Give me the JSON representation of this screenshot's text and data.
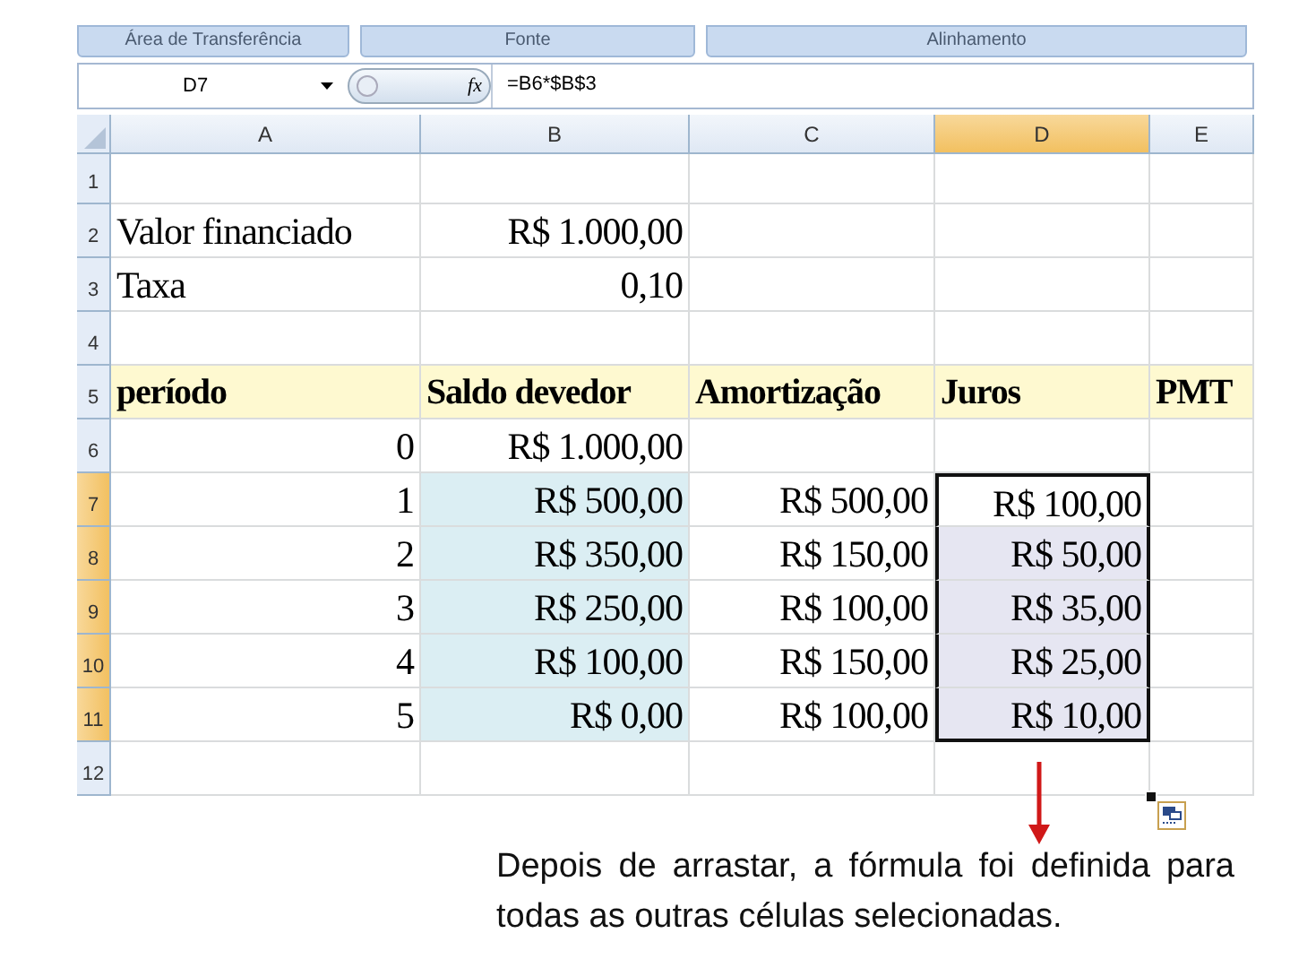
{
  "ribbon_groups": [
    "Área de Transferência",
    "Fonte",
    "Alinhamento"
  ],
  "formula_bar": {
    "name_box": "D7",
    "fx": "fx",
    "formula": "=B6*$B$3"
  },
  "columns": [
    {
      "label": "A",
      "selected": false
    },
    {
      "label": "B",
      "selected": false
    },
    {
      "label": "C",
      "selected": false
    },
    {
      "label": "D",
      "selected": true
    },
    {
      "label": "E",
      "selected": false
    }
  ],
  "rows": [
    {
      "number": "1",
      "selected": false,
      "band": false,
      "cells": [
        {
          "kind": "blank",
          "highlight": false,
          "selected": false
        },
        {
          "kind": "blank",
          "highlight": false,
          "selected": false
        },
        {
          "kind": "blank",
          "highlight": false,
          "selected": false
        },
        {
          "kind": "blank",
          "highlight": false,
          "selected": false
        },
        {
          "kind": "blank",
          "highlight": false,
          "selected": false
        }
      ]
    },
    {
      "number": "2",
      "selected": false,
      "band": false,
      "cells": [
        {
          "kind": "label",
          "text": "Valor financiado",
          "highlight": false,
          "selected": false
        },
        {
          "kind": "value",
          "text": "R$ 1.000,00",
          "highlight": false,
          "selected": false
        },
        {
          "kind": "blank",
          "highlight": false,
          "selected": false
        },
        {
          "kind": "blank",
          "highlight": false,
          "selected": false
        },
        {
          "kind": "blank",
          "highlight": false,
          "selected": false
        }
      ]
    },
    {
      "number": "3",
      "selected": false,
      "band": false,
      "cells": [
        {
          "kind": "label",
          "text": "Taxa",
          "highlight": false,
          "selected": false
        },
        {
          "kind": "value",
          "text": "0,10",
          "highlight": false,
          "selected": false
        },
        {
          "kind": "blank",
          "highlight": false,
          "selected": false
        },
        {
          "kind": "blank",
          "highlight": false,
          "selected": false
        },
        {
          "kind": "blank",
          "highlight": false,
          "selected": false
        }
      ]
    },
    {
      "number": "4",
      "selected": false,
      "band": false,
      "cells": [
        {
          "kind": "blank",
          "highlight": false,
          "selected": false
        },
        {
          "kind": "blank",
          "highlight": false,
          "selected": false
        },
        {
          "kind": "blank",
          "highlight": false,
          "selected": false
        },
        {
          "kind": "blank",
          "highlight": false,
          "selected": false
        },
        {
          "kind": "blank",
          "highlight": false,
          "selected": false
        }
      ]
    },
    {
      "number": "5",
      "selected": false,
      "band": true,
      "cells": [
        {
          "kind": "heading",
          "text": "período",
          "highlight": false,
          "selected": false
        },
        {
          "kind": "heading",
          "text": "Saldo devedor",
          "highlight": false,
          "selected": false
        },
        {
          "kind": "heading",
          "text": "Amortização",
          "highlight": false,
          "selected": false
        },
        {
          "kind": "heading",
          "text": "Juros",
          "highlight": false,
          "selected": false
        },
        {
          "kind": "heading",
          "text": "PMT",
          "highlight": false,
          "selected": false
        }
      ]
    },
    {
      "number": "6",
      "selected": false,
      "band": false,
      "cells": [
        {
          "kind": "value",
          "text": "0",
          "highlight": false,
          "selected": false
        },
        {
          "kind": "value",
          "text": "R$ 1.000,00",
          "highlight": false,
          "selected": false
        },
        {
          "kind": "blank",
          "highlight": false,
          "selected": false
        },
        {
          "kind": "blank",
          "highlight": false,
          "selected": false
        },
        {
          "kind": "blank",
          "highlight": false,
          "selected": false
        }
      ]
    },
    {
      "number": "7",
      "selected": true,
      "band": false,
      "cells": [
        {
          "kind": "value",
          "text": "1",
          "highlight": false,
          "selected": false
        },
        {
          "kind": "value",
          "text": "R$ 500,00",
          "highlight": true,
          "selected": false
        },
        {
          "kind": "value",
          "text": "R$ 500,00",
          "highlight": false,
          "selected": false
        },
        {
          "kind": "value",
          "text": "R$ 100,00",
          "highlight": false,
          "selected": true
        },
        {
          "kind": "blank",
          "highlight": false,
          "selected": false
        }
      ]
    },
    {
      "number": "8",
      "selected": true,
      "band": false,
      "cells": [
        {
          "kind": "value",
          "text": "2",
          "highlight": false,
          "selected": false
        },
        {
          "kind": "value",
          "text": "R$ 350,00",
          "highlight": true,
          "selected": false
        },
        {
          "kind": "value",
          "text": "R$ 150,00",
          "highlight": false,
          "selected": false
        },
        {
          "kind": "value",
          "text": "R$ 50,00",
          "highlight": false,
          "selected": true
        },
        {
          "kind": "blank",
          "highlight": false,
          "selected": false
        }
      ]
    },
    {
      "number": "9",
      "selected": true,
      "band": false,
      "cells": [
        {
          "kind": "value",
          "text": "3",
          "highlight": false,
          "selected": false
        },
        {
          "kind": "value",
          "text": "R$ 250,00",
          "highlight": true,
          "selected": false
        },
        {
          "kind": "value",
          "text": "R$ 100,00",
          "highlight": false,
          "selected": false
        },
        {
          "kind": "value",
          "text": "R$ 35,00",
          "highlight": false,
          "selected": true
        },
        {
          "kind": "blank",
          "highlight": false,
          "selected": false
        }
      ]
    },
    {
      "number": "10",
      "selected": true,
      "band": false,
      "cells": [
        {
          "kind": "value",
          "text": "4",
          "highlight": false,
          "selected": false
        },
        {
          "kind": "value",
          "text": "R$ 100,00",
          "highlight": true,
          "selected": false
        },
        {
          "kind": "value",
          "text": "R$ 150,00",
          "highlight": false,
          "selected": false
        },
        {
          "kind": "value",
          "text": "R$ 25,00",
          "highlight": false,
          "selected": true
        },
        {
          "kind": "blank",
          "highlight": false,
          "selected": false
        }
      ]
    },
    {
      "number": "11",
      "selected": true,
      "band": false,
      "cells": [
        {
          "kind": "value",
          "text": "5",
          "highlight": false,
          "selected": false
        },
        {
          "kind": "value",
          "text": "R$ 0,00",
          "highlight": true,
          "selected": false
        },
        {
          "kind": "value",
          "text": "R$ 100,00",
          "highlight": false,
          "selected": false
        },
        {
          "kind": "value",
          "text": "R$ 10,00",
          "highlight": false,
          "selected": true
        },
        {
          "kind": "blank",
          "highlight": false,
          "selected": false
        }
      ]
    },
    {
      "number": "12",
      "selected": false,
      "band": false,
      "cells": [
        {
          "kind": "blank",
          "highlight": false,
          "selected": false
        },
        {
          "kind": "blank",
          "highlight": false,
          "selected": false
        },
        {
          "kind": "blank",
          "highlight": false,
          "selected": false
        },
        {
          "kind": "blank",
          "highlight": false,
          "selected": false
        },
        {
          "kind": "blank",
          "highlight": false,
          "selected": false
        }
      ]
    }
  ],
  "caption": "Depois de arrastar, a fórmula foi definida para todas as outras células selecionadas."
}
